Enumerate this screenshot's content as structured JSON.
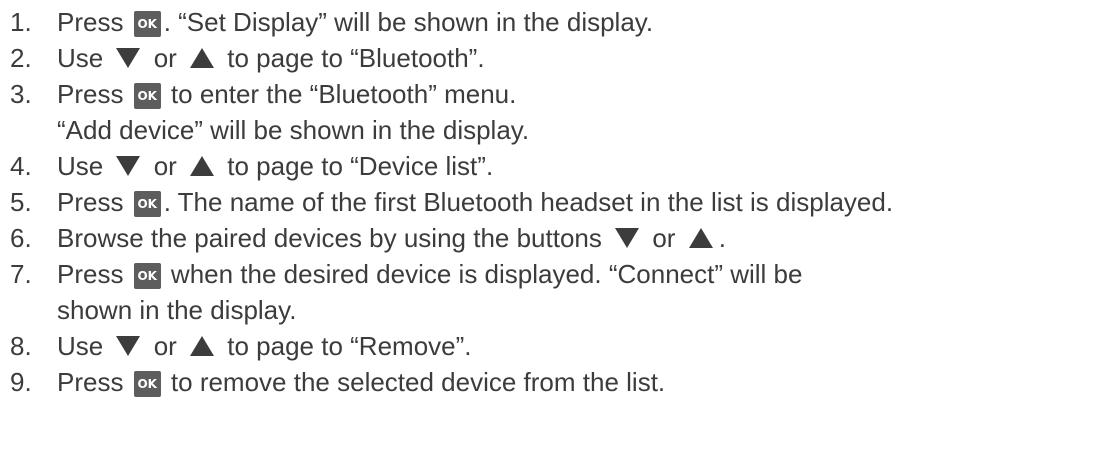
{
  "colors": {
    "text": "#3c3c3c",
    "button_bg": "#5d5d5d",
    "button_text": "#ffffff",
    "arrow": "#3c3c3c"
  },
  "icons": {
    "ok_button": "ok-button-icon",
    "down": "arrow-down-icon",
    "up": "arrow-up-icon"
  },
  "ok_label": "OK",
  "steps": [
    {
      "num": "1.",
      "a": "Press ",
      "b": ". “Set Display” will be shown in the display."
    },
    {
      "num": "2.",
      "a": "Use ",
      "or": " or ",
      "b": " to page to “Bluetooth”."
    },
    {
      "num": "3.",
      "a": "Press ",
      "b": " to enter the “Bluetooth” menu.",
      "c": "“Add device” will be shown in the display."
    },
    {
      "num": "4.",
      "a": "Use ",
      "or": " or ",
      "b": " to page to “Device list”."
    },
    {
      "num": "5.",
      "a": "Press ",
      "b": ". The name of the first Bluetooth headset in the list is displayed."
    },
    {
      "num": "6.",
      "a": "Browse the paired devices by using the buttons ",
      "or": " or ",
      "b": "."
    },
    {
      "num": "7.",
      "a": "Press ",
      "b": " when the desired device is displayed. “Connect” will be",
      "c": "shown in the display."
    },
    {
      "num": "8.",
      "a": "Use ",
      "or": " or ",
      "b": " to page to “Remove”."
    },
    {
      "num": "9.",
      "a": "Press ",
      "b": " to remove the selected device from the list."
    }
  ]
}
